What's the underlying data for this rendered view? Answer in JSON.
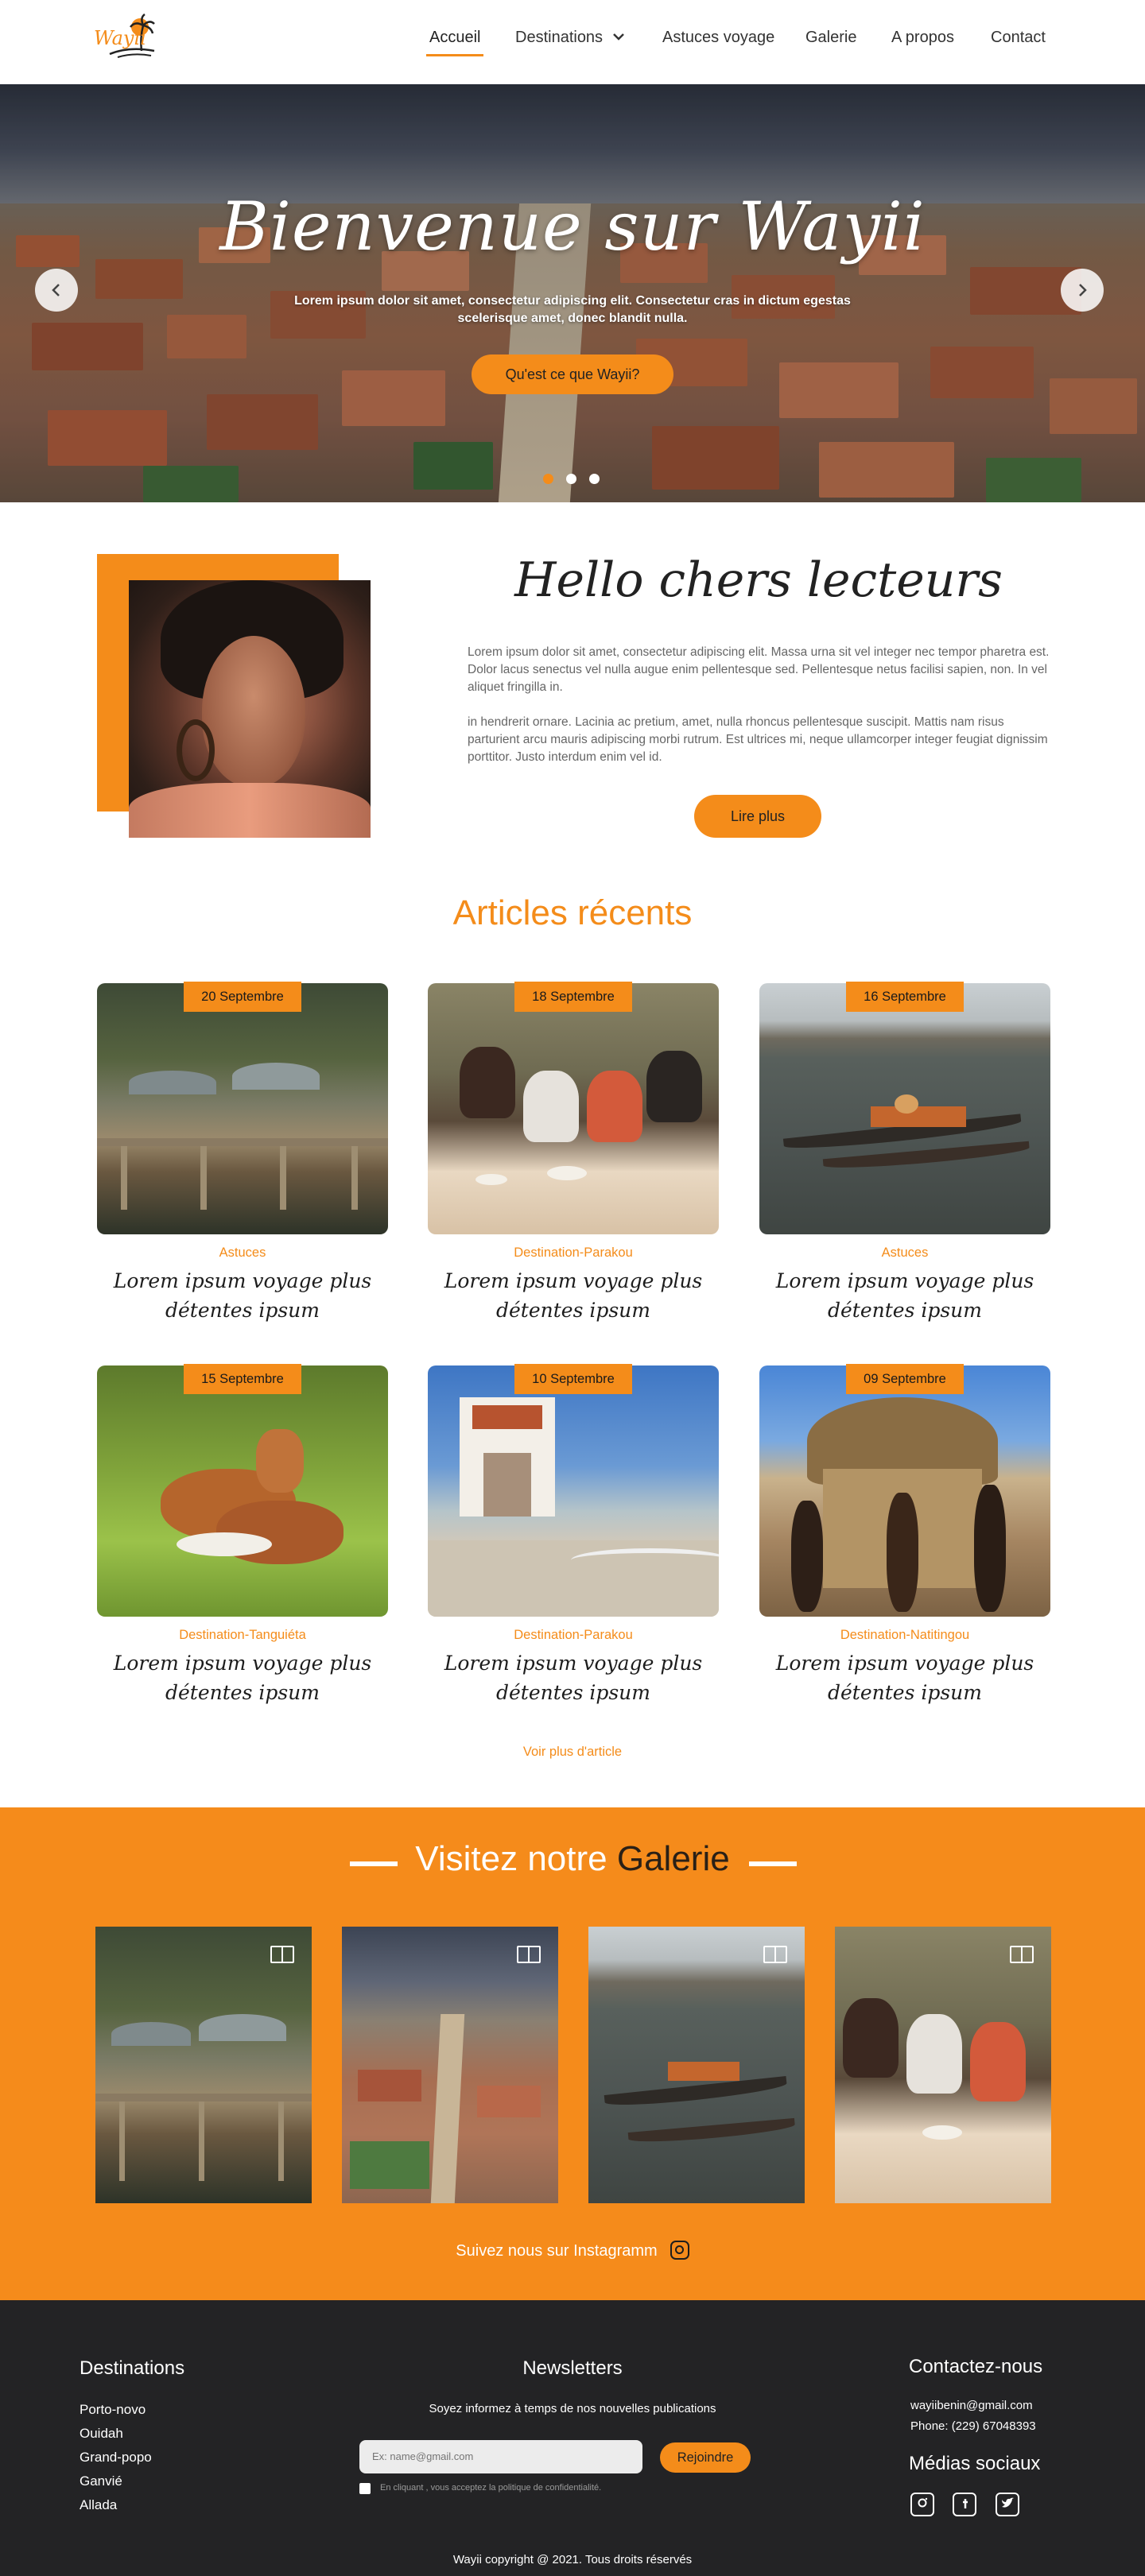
{
  "brand": {
    "logo_text": "Wayii",
    "accent": "#f48c1a",
    "dark": "#232325"
  },
  "nav": {
    "items": [
      {
        "label": "Accueil",
        "active": true
      },
      {
        "label": "Destinations"
      },
      {
        "label": "Astuces voyage"
      },
      {
        "label": "Galerie"
      },
      {
        "label": "A propos"
      },
      {
        "label": "Contact"
      }
    ]
  },
  "hero": {
    "title": "Bienvenue sur Wayii",
    "subtitle": "Lorem ipsum dolor sit amet, consectetur adipiscing elit. Consectetur cras in dictum egestas scelerisque amet, donec blandit nulla.",
    "button": "Qu'est ce que  Wayii?",
    "prev_icon": "chevron-left-icon",
    "next_icon": "chevron-right-icon",
    "slide_count": 3,
    "active_slide": 1
  },
  "hello": {
    "title": "Hello chers lecteurs",
    "p1": "Lorem ipsum dolor sit amet, consectetur adipiscing elit. Massa urna sit vel integer nec tempor pharetra est. Dolor lacus senectus vel nulla augue enim pellentesque sed. Pellentesque netus facilisi sapien, non. In vel aliquet fringilla in.",
    "p2": "in hendrerit ornare. Lacinia ac pretium, amet, nulla rhoncus pellentesque suscipit. Mattis nam risus parturient arcu mauris adipiscing morbi rutrum. Est ultrices mi, neque ullamcorper integer feugiat dignissim porttitor. Justo interdum enim vel id.",
    "button": "Lire plus"
  },
  "articles": {
    "title": "Articles récents",
    "items": [
      {
        "date": "20 Septembre",
        "category": "Astuces",
        "title": "Lorem ipsum voyage plus détentes ipsum"
      },
      {
        "date": "18 Septembre",
        "category": "Destination-Parakou",
        "title": "Lorem ipsum voyage plus détentes ipsum"
      },
      {
        "date": "16 Septembre",
        "category": "Astuces",
        "title": "Lorem ipsum voyage plus détentes ipsum"
      },
      {
        "date": "15 Septembre",
        "category": "Destination-Tanguiéta",
        "title": "Lorem ipsum voyage plus détentes ipsum"
      },
      {
        "date": "10 Septembre",
        "category": "Destination-Parakou",
        "title": "Lorem ipsum voyage plus détentes ipsum"
      },
      {
        "date": "09 Septembre",
        "category": "Destination-Natitingou",
        "title": "Lorem ipsum voyage plus détentes ipsum"
      }
    ],
    "more": "Voir plus d'article"
  },
  "gallery": {
    "title_light": "Visitez notre ",
    "title_dark": "Galerie",
    "item_icon": "book-open-icon",
    "instagram": "Suivez nous sur Instagramm",
    "instagram_icon": "instagram-icon"
  },
  "footer": {
    "destinations": {
      "title": "Destinations",
      "items": [
        "Porto-novo",
        "Ouidah",
        "Grand-popo",
        "Ganvié",
        "Allada"
      ]
    },
    "newsletter": {
      "title": "Newsletters",
      "text": "Soyez informez à temps de nos nouvelles publications",
      "placeholder": "Ex: name@gmail.com",
      "button": "Rejoindre",
      "consent": "En cliquant , vous acceptez la politique de confidentialité."
    },
    "contact": {
      "title": "Contactez-nous",
      "email": "wayiibenin@gmail.com",
      "phone": "Phone: (229) 67048393",
      "social_title": "Médias sociaux",
      "social_icons": [
        "instagram-icon",
        "facebook-icon",
        "twitter-icon"
      ]
    },
    "copyright": "Wayii copyright @ 2021. Tous droits réservés"
  }
}
